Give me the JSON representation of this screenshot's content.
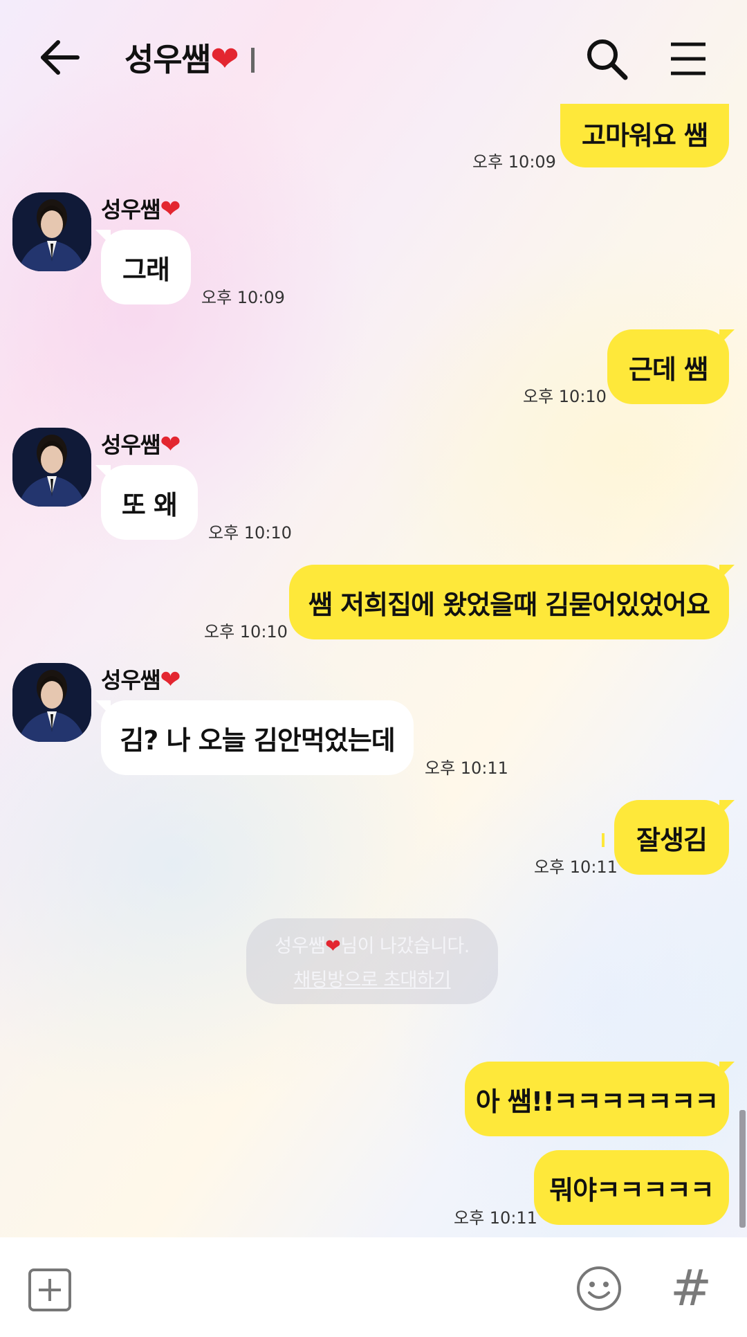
{
  "header": {
    "title": "성우쌤",
    "title_heart": "❤"
  },
  "messages": [
    {
      "from": "me",
      "text": "고마워요 쌤",
      "time": "오후 10:09"
    },
    {
      "from": "them",
      "sender": "성우쌤",
      "heart": "❤",
      "text": "그래",
      "time": "오후 10:09"
    },
    {
      "from": "me",
      "text": "근데 쌤",
      "time": "오후 10:10"
    },
    {
      "from": "them",
      "sender": "성우쌤",
      "heart": "❤",
      "text": "또 왜",
      "time": "오후 10:10"
    },
    {
      "from": "me",
      "text": "쌤 저희집에 왔었을때 김묻어있었어요",
      "time": "오후 10:10"
    },
    {
      "from": "them",
      "sender": "성우쌤",
      "heart": "❤",
      "text": "김? 나 오늘 김안먹었는데",
      "time": "오후 10:11"
    },
    {
      "from": "me",
      "text": "잘생김",
      "time": "오후 10:11"
    },
    {
      "from": "me",
      "text": "아 쌤!!ㅋㅋㅋㅋㅋㅋㅋ",
      "time": ""
    },
    {
      "from": "me",
      "text": "뭐야ㅋㅋㅋㅋㅋ",
      "time": "오후 10:11"
    }
  ],
  "notice": {
    "name": "성우쌤",
    "heart": "❤",
    "left_text": "님이 나갔습니다.",
    "invite_label": "채팅방으로 초대하기"
  },
  "input_bar": {
    "hash_label": "#"
  },
  "colors": {
    "my_bubble": "#fee83a",
    "their_bubble": "#ffffff",
    "heart": "#e32630"
  }
}
